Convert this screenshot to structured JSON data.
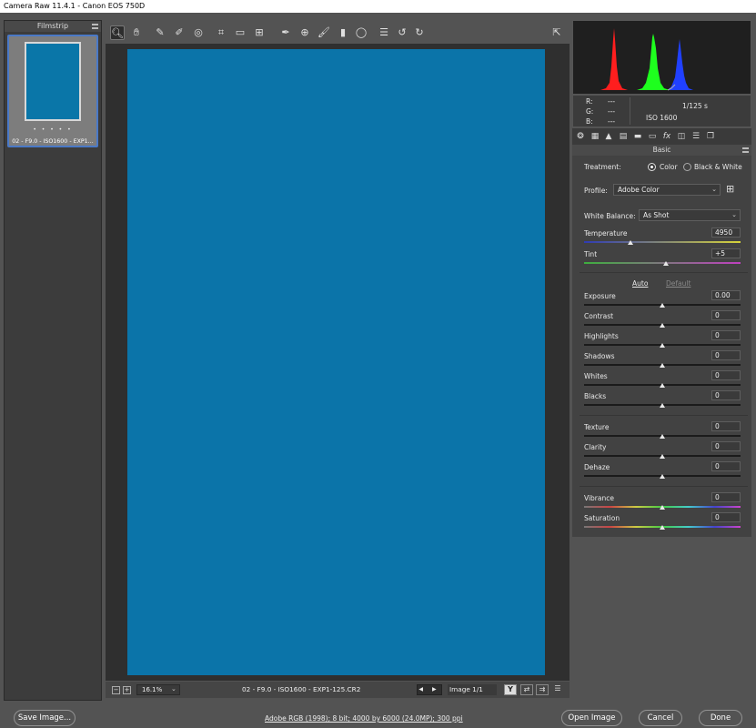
{
  "window": {
    "title": "Camera Raw 11.4.1  -  Canon EOS 750D"
  },
  "filmstrip": {
    "header": "Filmstrip",
    "thumb_stars": "• • • • •",
    "thumb_caption": "02 - F9.0 - ISO1600 - EXP1..."
  },
  "toolbar": {
    "tools": [
      "zoom-icon",
      "hand-icon",
      "white-balance-icon",
      "color-sampler-icon",
      "target-adjust-icon",
      "crop-icon",
      "straighten-icon",
      "transform-icon",
      "spot-removal-icon",
      "red-eye-icon",
      "adjustment-brush-icon",
      "graduated-filter-icon",
      "radial-filter-icon",
      "preferences-icon",
      "rotate-ccw-icon",
      "rotate-cw-icon"
    ],
    "fullscreen_icon": "fullscreen-icon"
  },
  "canvas": {
    "photo_color": "#0b74a9"
  },
  "bottombar": {
    "zoom": "16.1%",
    "filename": "02 - F9.0 - ISO1600 - EXP1-125.CR2",
    "nav": "◀ ▶",
    "image_count": "Image 1/1",
    "y_button": "Y"
  },
  "histogram": {
    "colors": {
      "red": "#ff1e1e",
      "green": "#1eff1e",
      "blue": "#2040ff"
    }
  },
  "info": {
    "r_label": "R:",
    "g_label": "G:",
    "b_label": "B:",
    "r_val": "---",
    "g_val": "---",
    "b_val": "---",
    "shutter": "1/125 s",
    "iso": "ISO 1600"
  },
  "panel": {
    "title": "Basic",
    "treatment_label": "Treatment:",
    "treatment_color": "Color",
    "treatment_bw": "Black & White",
    "profile_label": "Profile:",
    "profile_value": "Adobe Color",
    "wb_label": "White Balance:",
    "wb_value": "As Shot",
    "auto": "Auto",
    "default": "Default",
    "sliders": {
      "temperature": {
        "label": "Temperature",
        "value": "4950"
      },
      "tint": {
        "label": "Tint",
        "value": "+5"
      },
      "exposure": {
        "label": "Exposure",
        "value": "0.00"
      },
      "contrast": {
        "label": "Contrast",
        "value": "0"
      },
      "highlights": {
        "label": "Highlights",
        "value": "0"
      },
      "shadows": {
        "label": "Shadows",
        "value": "0"
      },
      "whites": {
        "label": "Whites",
        "value": "0"
      },
      "blacks": {
        "label": "Blacks",
        "value": "0"
      },
      "texture": {
        "label": "Texture",
        "value": "0"
      },
      "clarity": {
        "label": "Clarity",
        "value": "0"
      },
      "dehaze": {
        "label": "Dehaze",
        "value": "0"
      },
      "vibrance": {
        "label": "Vibrance",
        "value": "0"
      },
      "saturation": {
        "label": "Saturation",
        "value": "0"
      }
    }
  },
  "footer": {
    "save": "Save Image...",
    "info": "Adobe RGB (1998); 8 bit; 4000 by 6000 (24.0MP); 300 ppi",
    "open": "Open Image",
    "cancel": "Cancel",
    "done": "Done"
  }
}
